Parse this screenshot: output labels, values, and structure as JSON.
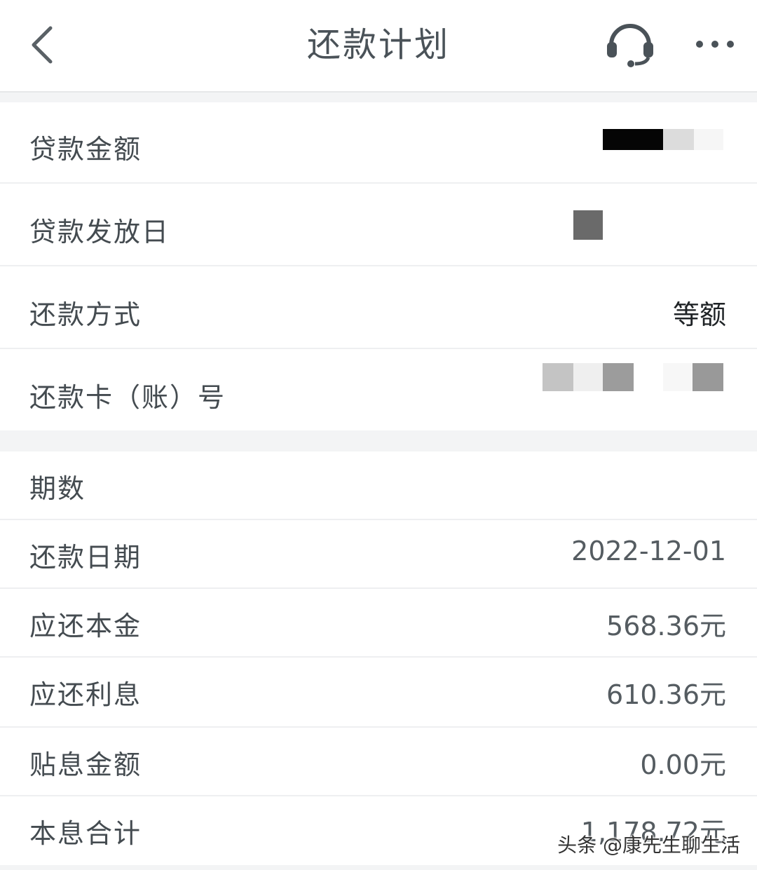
{
  "header": {
    "title": "还款计划",
    "back_icon": "chevron-left-icon",
    "service_icon": "headset-icon",
    "more_icon": "more-horizontal-icon"
  },
  "loan_info": {
    "amount_label": "贷款金额",
    "issue_date_label": "贷款发放日",
    "method_label": "还款方式",
    "method_value": "等额",
    "card_label": "还款卡（账）号"
  },
  "installment": {
    "period_label": "期数",
    "date_label": "还款日期",
    "date_value": "2022-12-01",
    "principal_label": "应还本金",
    "principal_value": "568.36元",
    "interest_label": "应还利息",
    "interest_value": "610.36元",
    "subsidy_label": "贴息金额",
    "subsidy_value": "0.00元",
    "total_label": "本息合计",
    "total_value": "1,178.72元"
  },
  "watermark": "头条 @康先生聊生活",
  "colors": {
    "background": "#f3f4f5",
    "card": "#ffffff",
    "text_primary": "#444b50",
    "text_value": "#555c61",
    "divider": "#eeeff1"
  }
}
